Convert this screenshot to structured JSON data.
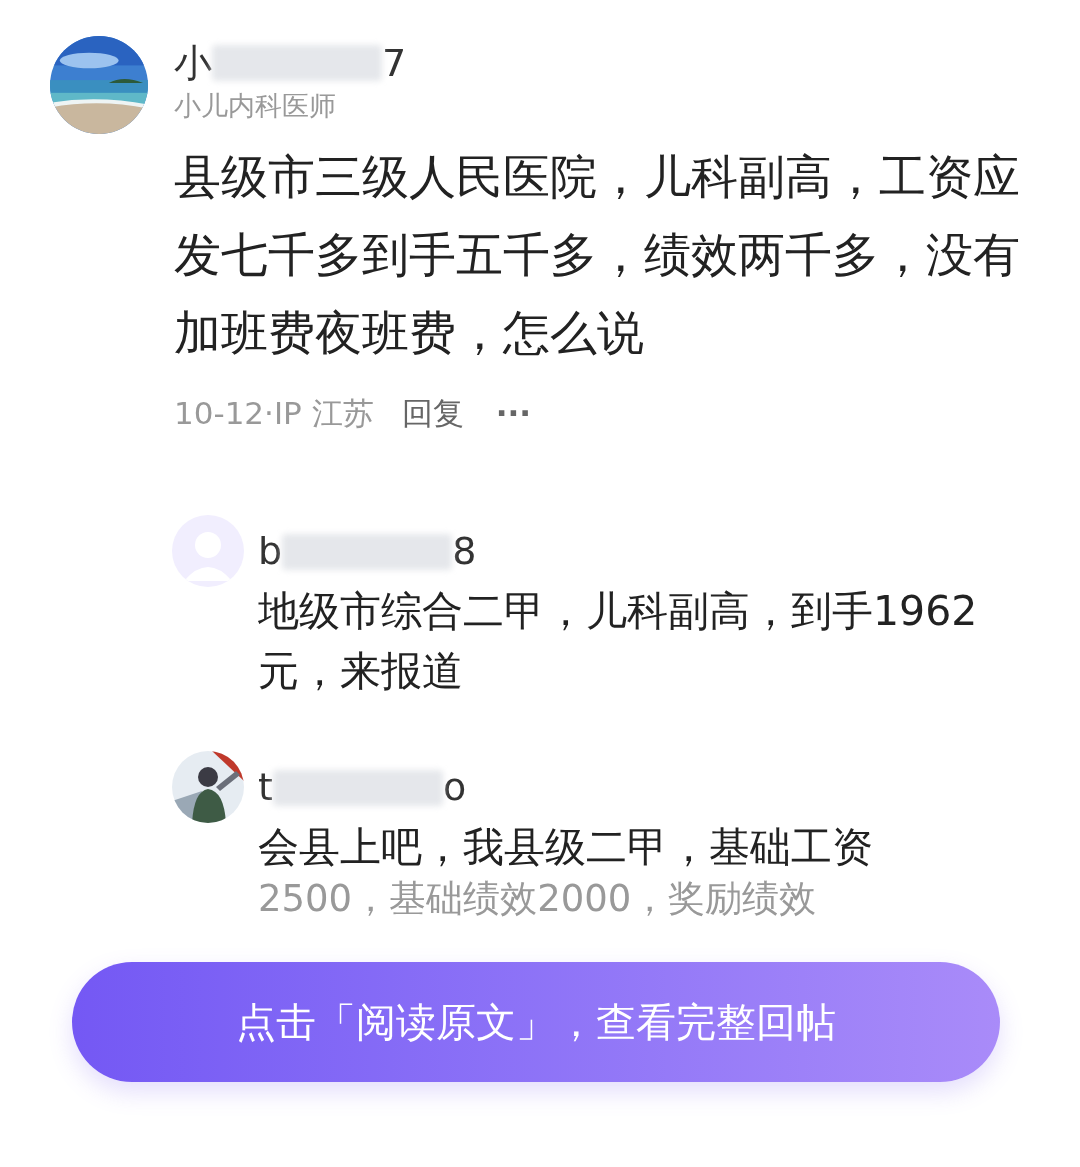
{
  "post": {
    "author": {
      "name_start": "小",
      "name_end": "7",
      "title": "小儿内科医师"
    },
    "text": "县级市三级人民医院，儿科副高，工资应发七千多到手五千多，绩效两千多，没有加班费夜班费，怎么说",
    "meta": "10-12·IP 江苏",
    "reply_label": "回复",
    "more": "···"
  },
  "replies": [
    {
      "kind": "default",
      "name_start": "b",
      "name_end": "8",
      "text": "地级市综合二甲，儿科副高，到手1962元，来报道"
    },
    {
      "kind": "picture",
      "name_start": "t",
      "name_end": "o",
      "text": "会县上吧，我县级二甲，基础工资",
      "cut_line": "2500，基础绩效2000，奖励绩效"
    }
  ],
  "button": {
    "label": "点击「阅读原文」，查看完整回帖"
  }
}
